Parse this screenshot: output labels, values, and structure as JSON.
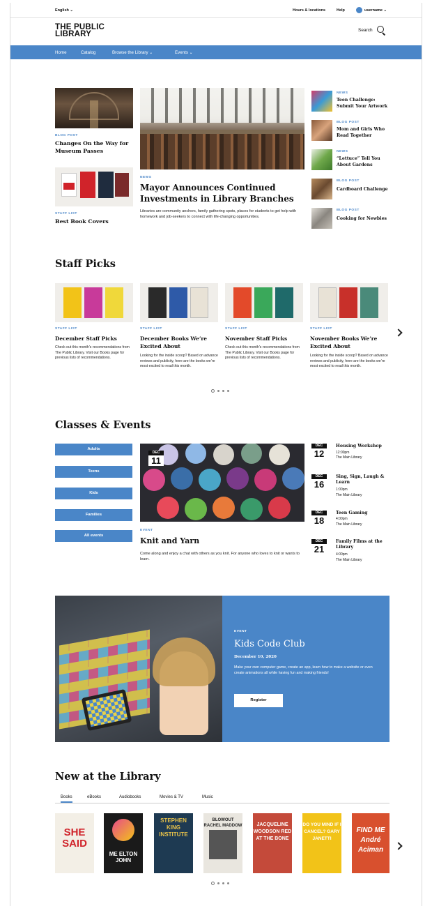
{
  "utility": {
    "language": "English ⌄",
    "hours": "Hours & locations",
    "help": "Help",
    "username": "username ⌄"
  },
  "header": {
    "logo_line1": "THE PUBLIC",
    "logo_line2": "LIBRARY",
    "search_label": "Search"
  },
  "nav": {
    "home": "Home",
    "catalog": "Catalog",
    "browse": "Browse the Library ⌄",
    "events": "Events ⌄"
  },
  "featured": {
    "left_top": {
      "label": "BLOG POST",
      "title": "Changes On the Way for Museum Passes"
    },
    "left_bottom": {
      "label": "STAFF LIST",
      "title": "Best Book Covers"
    },
    "main": {
      "label": "NEWS",
      "title": "Mayor Announces Continued Investments in Library Branches",
      "body": "Libraries are community anchors, family gathering spots, places for students to get help with homework and job-seekers to connect with life-changing opportunities."
    },
    "side": [
      {
        "label": "NEWS",
        "title": "Teen Challenge: Submit Your Artwork"
      },
      {
        "label": "BLOG POST",
        "title": "Mom and Girls Who Read Together"
      },
      {
        "label": "NEWS",
        "title": "“Lettuce” Tell You About Gardens"
      },
      {
        "label": "BLOG POST",
        "title": "Cardboard Challenge"
      },
      {
        "label": "BLOG POST",
        "title": "Cooking for Newbies"
      }
    ]
  },
  "staff_picks": {
    "heading": "Staff Picks",
    "cards": [
      {
        "label": "STAFF LIST",
        "title": "December Staff Picks",
        "body": "Check out this month’s recommendations from The Public Library. Visit our Books page for previous lists of recommendations."
      },
      {
        "label": "STAFF LIST",
        "title": "December Books We’re Excited About",
        "body": "Looking for the inside scoop? Based on advance reviews and publicity, here are the books we’re most excited to read this month."
      },
      {
        "label": "STAFF LIST",
        "title": "November Staff Picks",
        "body": "Check out this month’s recommendations from The Public Library. Visit our Books page for previous lists of recommendations."
      },
      {
        "label": "STAFF LIST",
        "title": "November Books We’re Excited About",
        "body": "Looking for the inside scoop? Based on advance reviews and publicity, here are the books we’re most excited to read this month."
      }
    ]
  },
  "classes_events": {
    "heading": "Classes & Events",
    "filters": [
      "Adults",
      "Teens",
      "Kids",
      "Families",
      "All events"
    ],
    "featured": {
      "month": "DEC",
      "day": "11",
      "label": "EVENT",
      "title": "Knit and Yarn",
      "body": "Come along and enjoy a chat with others as you knit. For anyone who loves to knit or wants to learn."
    },
    "list": [
      {
        "month": "DEC",
        "day": "12",
        "title": "Housing Workshop",
        "time": "12:00pm",
        "place": "The Main Library"
      },
      {
        "month": "DEC",
        "day": "16",
        "title": "Sing, Sign, Laugh & Learn",
        "time": "1:00pm",
        "place": "The Main Library"
      },
      {
        "month": "DEC",
        "day": "18",
        "title": "Teen Gaming",
        "time": "4:00pm",
        "place": "The Main Library"
      },
      {
        "month": "DEC",
        "day": "21",
        "title": "Family Films at the Library",
        "time": "4:00pm",
        "place": "The Main Library"
      }
    ]
  },
  "promo": {
    "label": "EVENT",
    "title": "Kids Code Club",
    "date": "December 10, 2020",
    "body": "Make your own computer game, create an app, learn how to make a website or even create animations all while having fun and making friends!",
    "button": "Register"
  },
  "new_at_library": {
    "heading": "New at the Library",
    "tabs": [
      "Books",
      "eBooks",
      "Audiobooks",
      "Movies & TV",
      "Music"
    ],
    "books": [
      {
        "title": "SHE SAID",
        "color": "#f3efe6",
        "text_color": "#d0232a"
      },
      {
        "title": "ME ELTON JOHN",
        "color": "#1a1a1a",
        "text_color": "#ffffff"
      },
      {
        "title": "STEPHEN KING INSTITUTE",
        "color": "#1e3a52",
        "text_color": "#e8c24a"
      },
      {
        "title": "BLOWOUT RACHEL MADDOW",
        "color": "#e9e6df",
        "text_color": "#222222"
      },
      {
        "title": "JACQUELINE WOODSON RED AT THE BONE",
        "color": "#c44a3a",
        "text_color": "#ffffff"
      },
      {
        "title": "DO YOU MIND IF I CANCEL? GARY JANETTI",
        "color": "#f2c318",
        "text_color": "#ffffff"
      },
      {
        "title": "FIND ME André Aciman",
        "color": "#d8502e",
        "text_color": "#ffffff"
      }
    ]
  },
  "colors": {
    "accent": "#4a86c8"
  }
}
